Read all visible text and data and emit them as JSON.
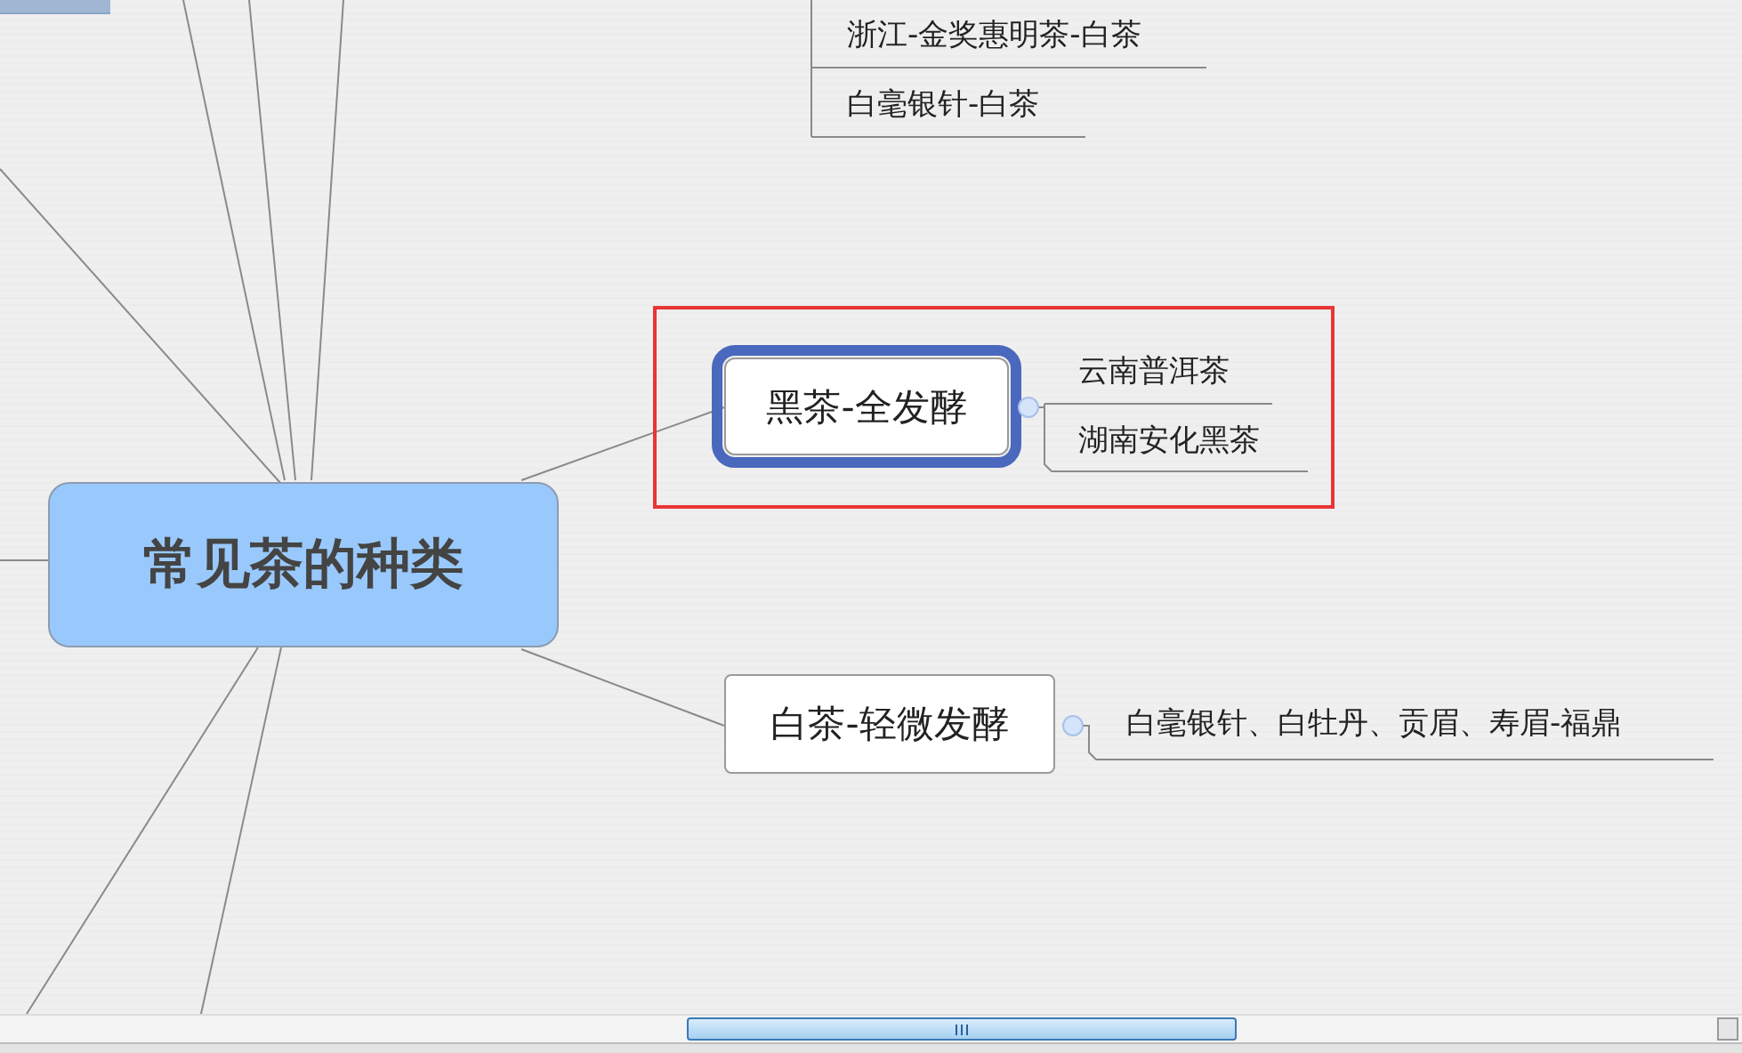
{
  "central_topic": {
    "label": "常见茶的种类"
  },
  "partial_subtopics": [
    {
      "label": "浙江-金奖惠明茶-白茶"
    },
    {
      "label": "白毫银针-白茶"
    }
  ],
  "topics": [
    {
      "label": "黑茶-全发酵",
      "selected": true,
      "annotated": true,
      "children": [
        {
          "label": "云南普洱茶"
        },
        {
          "label": "湖南安化黑茶"
        }
      ]
    },
    {
      "label": "白茶-轻微发酵",
      "selected": false,
      "annotated": false,
      "children": [
        {
          "label": "白毫银针、白牡丹、贡眉、寿眉-福鼎"
        }
      ]
    }
  ]
}
